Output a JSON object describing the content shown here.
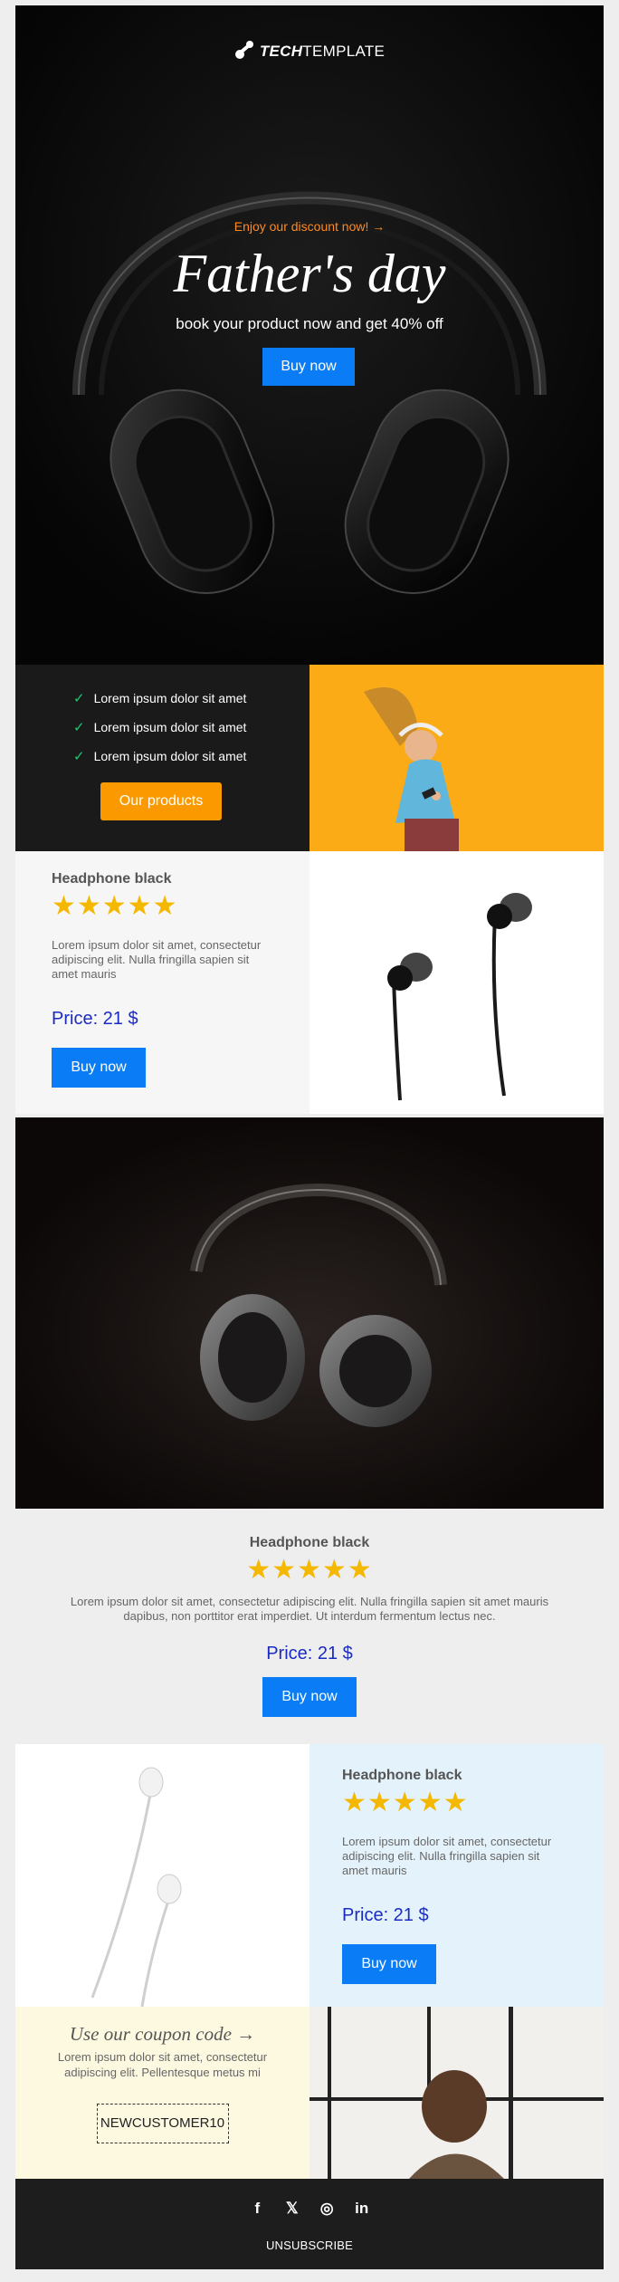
{
  "brand": {
    "bold": "TECH",
    "light": "TEMPLATE"
  },
  "hero": {
    "discount": "Enjoy our discount now! →",
    "title": "Father's day",
    "subtitle": "book your product now and get 40% off",
    "button": "Buy now"
  },
  "features": {
    "items": [
      "Lorem ipsum dolor sit amet",
      "Lorem ipsum dolor sit amet",
      "Lorem ipsum dolor sit amet"
    ],
    "check": "✓",
    "button": "Our products"
  },
  "product1": {
    "title": "Headphone black",
    "stars": "★★★★★",
    "rating": 5,
    "description": "Lorem ipsum dolor sit amet, consectetur adipiscing elit. Nulla fringilla sapien sit amet mauris",
    "price": "Price: 21 $",
    "button": "Buy now"
  },
  "product2": {
    "title": "Headphone black",
    "stars": "★★★★★",
    "rating": 5,
    "description": "Lorem ipsum dolor sit amet, consectetur adipiscing elit. Nulla fringilla sapien sit amet mauris dapibus, non porttitor erat imperdiet. Ut interdum fermentum lectus nec.",
    "price": "Price: 21 $",
    "button": "Buy now"
  },
  "product3": {
    "title": "Headphone black",
    "stars": "★★★★★",
    "rating": 5,
    "description": "Lorem ipsum dolor sit amet, consectetur adipiscing elit. Nulla fringilla sapien sit amet mauris",
    "price": "Price: 21 $",
    "button": "Buy now"
  },
  "coupon": {
    "title": "Use our coupon code →",
    "description": "Lorem ipsum dolor sit amet, consectetur adipiscing elit. Pellentesque metus mi",
    "code": "NEWCUSTOMER10"
  },
  "footer": {
    "social": [
      {
        "icon": "facebook-icon",
        "glyph": "f"
      },
      {
        "icon": "x-icon",
        "glyph": "𝕏"
      },
      {
        "icon": "instagram-icon",
        "glyph": "◎"
      },
      {
        "icon": "linkedin-icon",
        "glyph": "in"
      }
    ],
    "unsubscribe": "UNSUBSCRIBE"
  },
  "colors": {
    "accent_blue": "#0a7cf5",
    "accent_orange": "#fb9a00",
    "discount_orange": "#ff8a1f",
    "price_blue": "#1a2bc4",
    "star_yellow": "#f5b800",
    "check_green": "#25c56e"
  }
}
